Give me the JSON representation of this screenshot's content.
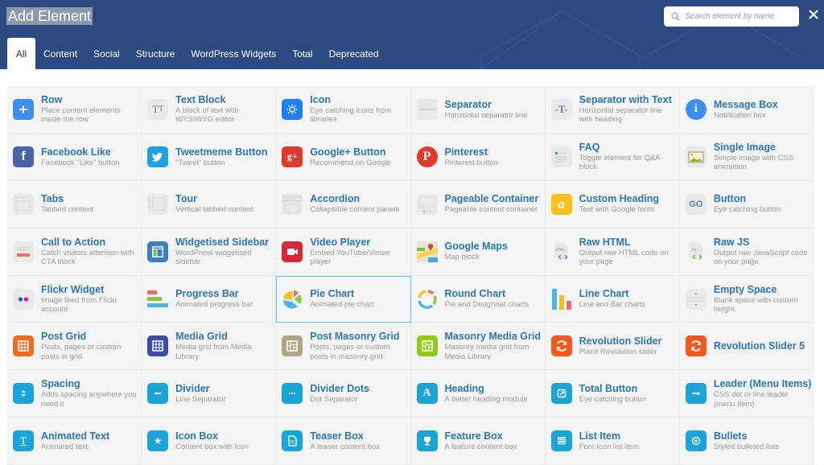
{
  "header": {
    "title": "Add Element",
    "search_placeholder": "Search element by name",
    "close_icon": "close-icon"
  },
  "colors": {
    "header_bg": "#2c4a80",
    "link_blue": "#2b77b1",
    "selected_border": "#5bc0eb",
    "cell_bg": "#f4f4f4"
  },
  "tabs": [
    {
      "label": "All",
      "active": true
    },
    {
      "label": "Content"
    },
    {
      "label": "Social"
    },
    {
      "label": "Structure"
    },
    {
      "label": "WordPress Widgets"
    },
    {
      "label": "Total"
    },
    {
      "label": "Deprecated"
    }
  ],
  "elements": [
    {
      "name": "Row",
      "desc": "Place content elements inside the row",
      "icon": "plus-icon"
    },
    {
      "name": "Text Block",
      "desc": "A block of text with WYSIWYG editor",
      "icon": "text-tt-icon"
    },
    {
      "name": "Icon",
      "desc": "Eye catching icons from libraries",
      "icon": "sun-icon"
    },
    {
      "name": "Separator",
      "desc": "Horizontal separator line",
      "icon": "separator-line-icon"
    },
    {
      "name": "Separator with Text",
      "desc": "Horizontal separator line with heading",
      "icon": "separator-text-icon"
    },
    {
      "name": "Message Box",
      "desc": "Notification box",
      "icon": "info-icon"
    },
    {
      "name": "Facebook Like",
      "desc": "Facebook \"Like\" button",
      "icon": "facebook-icon"
    },
    {
      "name": "Tweetmeme Button",
      "desc": "\"Tweet\" button",
      "icon": "twitter-icon"
    },
    {
      "name": "Google+ Button",
      "desc": "Recommend on Google",
      "icon": "google-plus-icon"
    },
    {
      "name": "Pinterest",
      "desc": "Pinterest button",
      "icon": "pinterest-icon"
    },
    {
      "name": "FAQ",
      "desc": "Toggle element for Q&A block",
      "icon": "faq-icon"
    },
    {
      "name": "Single Image",
      "desc": "Simple image with CSS animation",
      "icon": "image-icon"
    },
    {
      "name": "Tabs",
      "desc": "Tabbed content",
      "icon": "tabs-icon"
    },
    {
      "name": "Tour",
      "desc": "Vertical tabbed content",
      "icon": "tour-icon"
    },
    {
      "name": "Accordion",
      "desc": "Collapsible content panels",
      "icon": "accordion-icon"
    },
    {
      "name": "Pageable Container",
      "desc": "Pageable content container",
      "icon": "pageable-icon"
    },
    {
      "name": "Custom Heading",
      "desc": "Text with Google fonts",
      "icon": "custom-heading-icon"
    },
    {
      "name": "Button",
      "desc": "Eye catching button",
      "icon": "go-button-icon"
    },
    {
      "name": "Call to Action",
      "desc": "Catch visitors attention with CTA block",
      "icon": "cta-icon"
    },
    {
      "name": "Widgetised Sidebar",
      "desc": "WordPress widgetised sidebar",
      "icon": "sidebar-icon"
    },
    {
      "name": "Video Player",
      "desc": "Embed YouTube/Vimeo player",
      "icon": "video-icon"
    },
    {
      "name": "Google Maps",
      "desc": "Map block",
      "icon": "map-icon"
    },
    {
      "name": "Raw HTML",
      "desc": "Output raw HTML code on your page",
      "icon": "html-file-icon"
    },
    {
      "name": "Raw JS",
      "desc": "Output raw JavaScript code on your page",
      "icon": "js-file-icon"
    },
    {
      "name": "Flickr Widget",
      "desc": "Image feed from Flickr account",
      "icon": "flickr-icon"
    },
    {
      "name": "Progress Bar",
      "desc": "Animated progress bar",
      "icon": "progress-bar-icon"
    },
    {
      "name": "Pie Chart",
      "desc": "Animated pie chart",
      "icon": "pie-chart-icon",
      "selected": true
    },
    {
      "name": "Round Chart",
      "desc": "Pie and Doughnat charts",
      "icon": "round-chart-icon"
    },
    {
      "name": "Line Chart",
      "desc": "Line and Bar charts",
      "icon": "bar-chart-icon"
    },
    {
      "name": "Empty Space",
      "desc": "Blank space with custom height",
      "icon": "empty-space-icon"
    },
    {
      "name": "Post Grid",
      "desc": "Posts, pages or custom posts in grid",
      "icon": "post-grid-icon"
    },
    {
      "name": "Media Grid",
      "desc": "Media grid from Media Library",
      "icon": "media-grid-icon"
    },
    {
      "name": "Post Masonry Grid",
      "desc": "Posts, pages or custom posts in masonry grid",
      "icon": "masonry-grid-icon"
    },
    {
      "name": "Masonry Media Grid",
      "desc": "Masonry media grid from Media Library",
      "icon": "masonry-media-icon"
    },
    {
      "name": "Revolution Slider",
      "desc": "Place Revolution slider",
      "icon": "refresh-icon"
    },
    {
      "name": "Revolution Slider 5",
      "desc": "",
      "icon": "refresh-icon"
    },
    {
      "name": "Spacing",
      "desc": "Adds spacing anywhere you need it",
      "icon": "spacing-icon"
    },
    {
      "name": "Divider",
      "desc": "Line Separator",
      "icon": "minus-icon"
    },
    {
      "name": "Divider Dots",
      "desc": "Dot Separator",
      "icon": "dots-icon"
    },
    {
      "name": "Heading",
      "desc": "A better heading module",
      "icon": "letter-a-icon"
    },
    {
      "name": "Total Button",
      "desc": "Eye catching button",
      "icon": "external-link-icon"
    },
    {
      "name": "Leader (Menu Items)",
      "desc": "CSS dot or line leader (menu item)",
      "icon": "arrow-right-icon"
    },
    {
      "name": "Animated Text",
      "desc": "Animated text",
      "icon": "text-cursor-icon"
    },
    {
      "name": "Icon Box",
      "desc": "Content box with icon",
      "icon": "star-icon"
    },
    {
      "name": "Teaser Box",
      "desc": "A teaser content box",
      "icon": "document-icon"
    },
    {
      "name": "Feature Box",
      "desc": "A feature content box",
      "icon": "trophy-icon"
    },
    {
      "name": "List Item",
      "desc": "Font Icon list item",
      "icon": "list-icon"
    },
    {
      "name": "Bullets",
      "desc": "Styled bulleted lists",
      "icon": "bullet-circle-icon"
    }
  ]
}
